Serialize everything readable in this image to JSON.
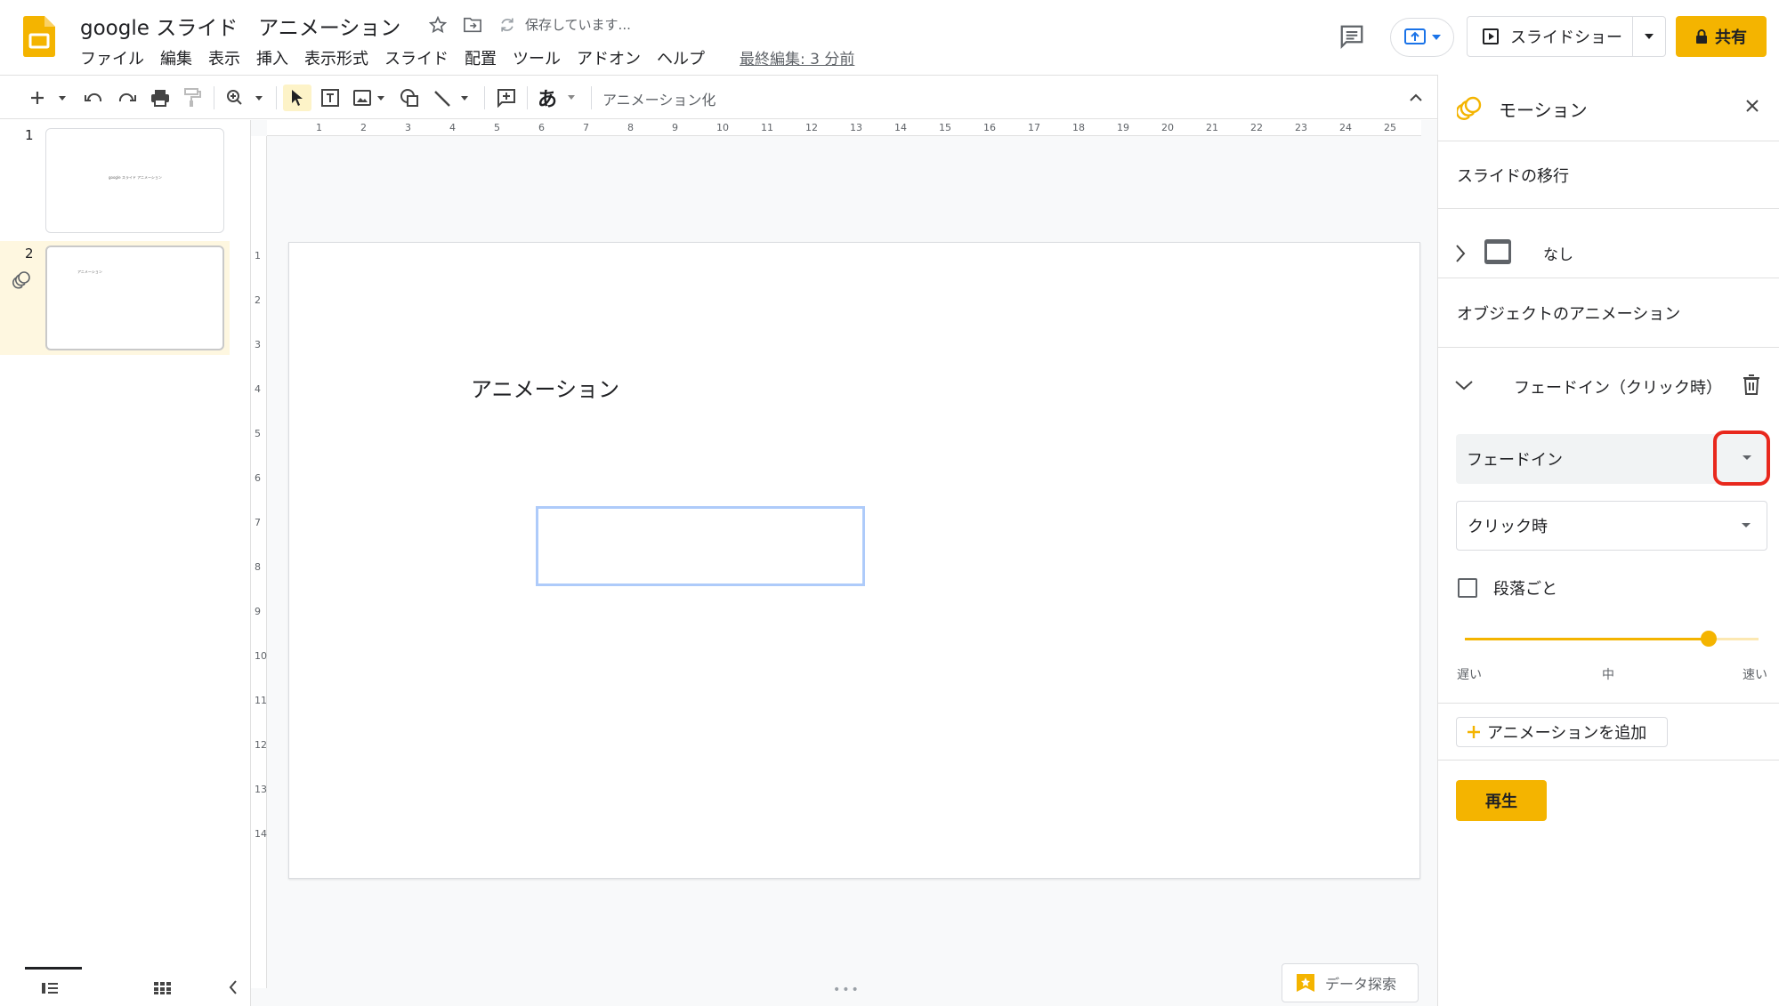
{
  "app": {
    "doc_title": "google スライド　アニメーション",
    "saving_status": "保存しています...",
    "last_edit": "最終編集: 3 分前",
    "brand_color": "#f4b400",
    "menu": [
      "ファイル",
      "編集",
      "表示",
      "挿入",
      "表示形式",
      "スライド",
      "配置",
      "ツール",
      "アドオン",
      "ヘルプ"
    ]
  },
  "header_actions": {
    "slideshow_label": "スライドショー",
    "share_label": "共有"
  },
  "toolbar": {
    "font_glyph": "あ",
    "animate_label": "アニメーション化"
  },
  "filmstrip": {
    "slides": [
      {
        "number": "1",
        "thumb_text": "google スライド アニメーション"
      },
      {
        "number": "2",
        "thumb_text": "アニメーション"
      }
    ]
  },
  "ruler": {
    "top": [
      "1",
      "2",
      "3",
      "4",
      "5",
      "6",
      "7",
      "8",
      "9",
      "10",
      "11",
      "12",
      "13",
      "14",
      "15",
      "16",
      "17",
      "18",
      "19",
      "20",
      "21",
      "22",
      "23",
      "24",
      "25"
    ],
    "left": [
      "1",
      "2",
      "3",
      "4",
      "5",
      "6",
      "7",
      "8",
      "9",
      "10",
      "11",
      "12",
      "13",
      "14"
    ]
  },
  "slide": {
    "title_text": "アニメーション"
  },
  "explore": {
    "label": "データ探索"
  },
  "motion_panel": {
    "title": "モーション",
    "transition_heading": "スライドの移行",
    "transition_value": "なし",
    "object_anim_heading": "オブジェクトのアニメーション",
    "anim_item_label": "フェードイン（クリック時）",
    "effect_value": "フェードイン",
    "trigger_value": "クリック時",
    "by_paragraph_label": "段落ごと",
    "speed": {
      "slow": "遅い",
      "medium": "中",
      "fast": "速い",
      "level": 0.83
    },
    "add_animation_label": "アニメーションを追加",
    "play_label": "再生",
    "highlight_color": "#e8281d"
  }
}
